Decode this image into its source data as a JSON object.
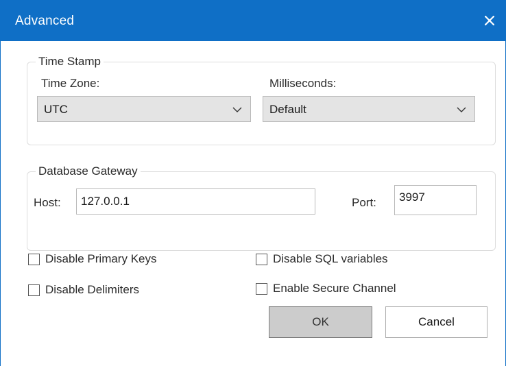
{
  "window": {
    "title": "Advanced",
    "close_icon": "close-icon"
  },
  "timestamp_group": {
    "legend": "Time Stamp",
    "timezone_label": "Time Zone:",
    "timezone_value": "UTC",
    "milliseconds_label": "Milliseconds:",
    "milliseconds_value": "Default"
  },
  "gateway_group": {
    "legend": "Database Gateway",
    "host_label": "Host:",
    "host_value": "127.0.0.1",
    "port_label": "Port:",
    "port_value": "3997"
  },
  "options": {
    "disable_primary_keys": {
      "label": "Disable Primary Keys",
      "checked": false
    },
    "disable_delimiters": {
      "label": "Disable Delimiters",
      "checked": false
    },
    "disable_sql_variables": {
      "label": "Disable SQL variables",
      "checked": false
    },
    "enable_secure_channel": {
      "label": "Enable Secure Channel",
      "checked": false
    }
  },
  "buttons": {
    "ok_label": "OK",
    "cancel_label": "Cancel"
  },
  "colors": {
    "titlebar": "#0f6fc6",
    "ok_button_bg": "#cccccc",
    "combo_bg": "#e4e4e4"
  }
}
